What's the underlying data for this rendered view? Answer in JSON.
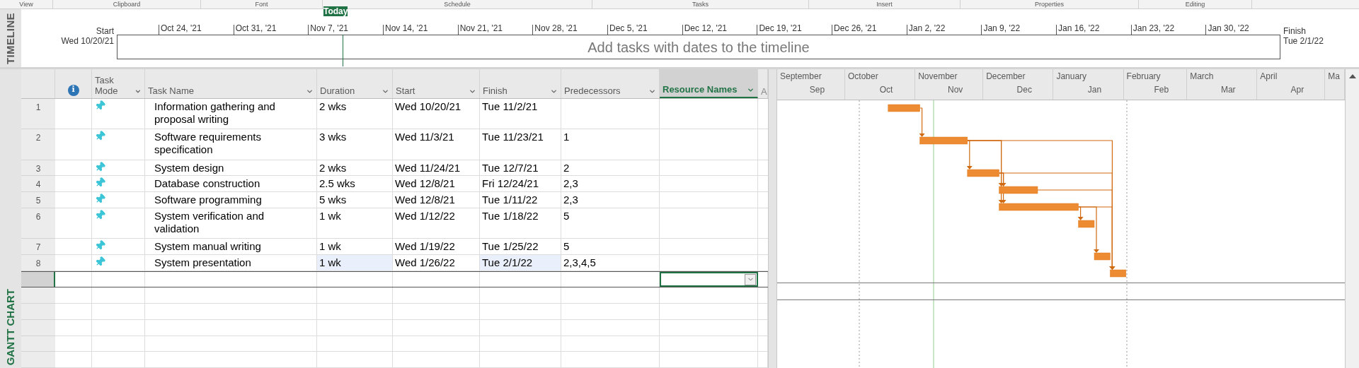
{
  "ribbon_groups": [
    "View",
    "Clipboard",
    "Font",
    "Schedule",
    "Tasks",
    "Insert",
    "Properties",
    "Editing"
  ],
  "timeline": {
    "side_label": "TIMELINE",
    "today": "Today",
    "start_label": "Start",
    "start_date": "Wed 10/20/21",
    "finish_label": "Finish",
    "finish_date": "Tue 2/1/22",
    "placeholder": "Add tasks with dates to the timeline",
    "ticks": [
      "Oct 24, '21",
      "Oct 31, '21",
      "Nov 7, '21",
      "Nov 14, '21",
      "Nov 21, '21",
      "Nov 28, '21",
      "Dec 5, '21",
      "Dec 12, '21",
      "Dec 19, '21",
      "Dec 26, '21",
      "Jan 2, '22",
      "Jan 9, '22",
      "Jan 16, '22",
      "Jan 23, '22",
      "Jan 30, '22"
    ]
  },
  "gantt": {
    "side_label": "GANTT CHART",
    "columns": [
      {
        "kind": "info",
        "label": "i"
      },
      {
        "kind": "text",
        "label": "Task Mode",
        "selected": false
      },
      {
        "kind": "text",
        "label": "Task Name",
        "selected": false
      },
      {
        "kind": "text",
        "label": "Duration",
        "selected": false
      },
      {
        "kind": "text",
        "label": "Start",
        "selected": false
      },
      {
        "kind": "text",
        "label": "Finish",
        "selected": false
      },
      {
        "kind": "text",
        "label": "Predecessors",
        "selected": false
      },
      {
        "kind": "text",
        "label": "Resource Names",
        "selected": true
      },
      {
        "kind": "add",
        "label": "A",
        "selected": false
      }
    ],
    "rows": [
      {
        "id": "1",
        "name": "Information gathering and proposal writing",
        "duration": "2 wks",
        "start": "Wed 10/20/21",
        "finish": "Tue 11/2/21",
        "predecessors": "",
        "changed": false
      },
      {
        "id": "2",
        "name": "Software requirements specification",
        "duration": "3 wks",
        "start": "Wed 11/3/21",
        "finish": "Tue 11/23/21",
        "predecessors": "1",
        "changed": false
      },
      {
        "id": "3",
        "name": "System design",
        "duration": "2 wks",
        "start": "Wed 11/24/21",
        "finish": "Tue 12/7/21",
        "predecessors": "2",
        "changed": false
      },
      {
        "id": "4",
        "name": "Database construction",
        "duration": "2.5 wks",
        "start": "Wed 12/8/21",
        "finish": "Fri 12/24/21",
        "predecessors": "2,3",
        "changed": false
      },
      {
        "id": "5",
        "name": "Software programming",
        "duration": "5 wks",
        "start": "Wed 12/8/21",
        "finish": "Tue 1/11/22",
        "predecessors": "2,3",
        "changed": false
      },
      {
        "id": "6",
        "name": "System verification and validation",
        "duration": "1 wk",
        "start": "Wed 1/12/22",
        "finish": "Tue 1/18/22",
        "predecessors": "5",
        "changed": false
      },
      {
        "id": "7",
        "name": "System manual writing",
        "duration": "1 wk",
        "start": "Wed 1/19/22",
        "finish": "Tue 1/25/22",
        "predecessors": "5",
        "changed": false
      },
      {
        "id": "8",
        "name": "System presentation",
        "duration": "1 wk",
        "start": "Wed 1/26/22",
        "finish": "Tue 2/1/22",
        "predecessors": "2,3,4,5",
        "changed": true
      }
    ],
    "new_row": {
      "selected": true
    },
    "months": [
      {
        "name": "September",
        "abbr": "Sep"
      },
      {
        "name": "October",
        "abbr": "Oct"
      },
      {
        "name": "November",
        "abbr": "Nov"
      },
      {
        "name": "December",
        "abbr": "Dec"
      },
      {
        "name": "January",
        "abbr": "Jan"
      },
      {
        "name": "February",
        "abbr": "Feb"
      },
      {
        "name": "March",
        "abbr": "Mar"
      },
      {
        "name": "April",
        "abbr": "Apr"
      },
      {
        "name": "Ma"
      }
    ]
  }
}
